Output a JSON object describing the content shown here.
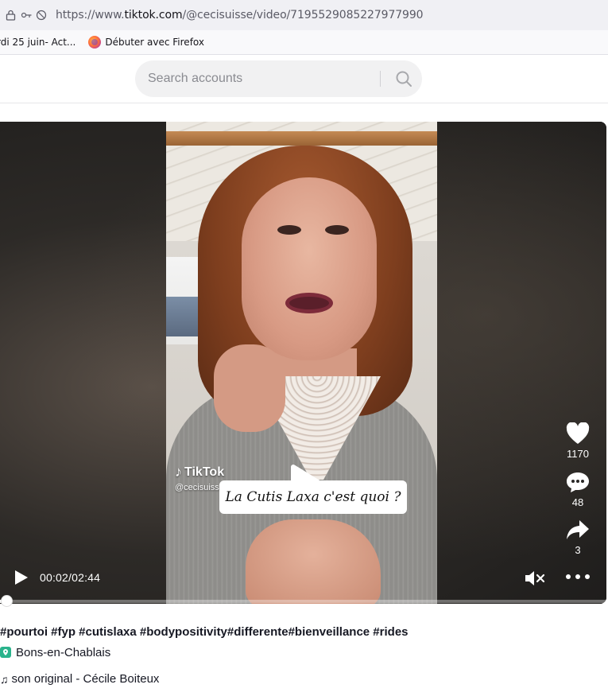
{
  "browser": {
    "url_prefix": "https://www.",
    "url_domain": "tiktok.com",
    "url_path": "/@cecisuisse/video/7195529085227977990",
    "bookmarks": [
      {
        "label": "rdi 25 juin- Act..."
      },
      {
        "label": "Débuter avec Firefox"
      }
    ]
  },
  "header": {
    "search_placeholder": "Search accounts"
  },
  "video": {
    "watermark_brand": "TikTok",
    "watermark_handle": "@cecisuisse",
    "caption": "La Cutis Laxa c'est quoi ?",
    "time": "00:02/02:44",
    "progress_fraction": 0.0125,
    "likes": "1170",
    "comments": "48",
    "shares": "3"
  },
  "post": {
    "description": "#pourtoi #fyp #cutislaxa #bodypositivity#differente#bienveillance #rides",
    "location": "Bons-en-Chablais",
    "music": "son original - Cécile Boiteux"
  },
  "colors": {
    "location_pin": "#2ab38c",
    "search_bg": "#f1f1f2",
    "text": "#161823"
  },
  "icons": [
    "lock-icon",
    "permissions-icon",
    "firefox-icon",
    "search-icon",
    "play-icon",
    "heart-icon",
    "comment-icon",
    "share-icon",
    "mute-icon",
    "more-icon",
    "location-pin-icon",
    "music-note-icon",
    "tiktok-logo-icon"
  ]
}
